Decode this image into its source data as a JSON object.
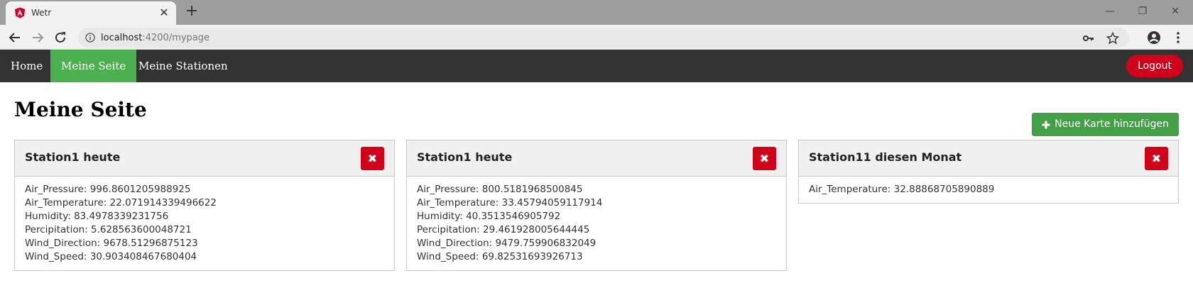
{
  "browser": {
    "tab_title": "Wetr",
    "url_host": "localhost",
    "url_path": ":4200/mypage",
    "icons": {
      "favicon": "angular-icon",
      "close": "close-icon",
      "new_tab": "plus-icon",
      "back": "back-arrow-icon",
      "forward": "forward-arrow-icon",
      "reload": "reload-icon",
      "info": "info-icon",
      "key": "key-icon",
      "star": "star-icon",
      "account": "account-icon",
      "menu": "kebab-menu-icon"
    }
  },
  "navbar": {
    "items": [
      {
        "label": "Home",
        "active": false
      },
      {
        "label": "Meine Seite",
        "active": true
      },
      {
        "label": "Meine Stationen",
        "active": false
      }
    ],
    "logout_label": "Logout",
    "colors": {
      "bg": "#333333",
      "active": "#4caf50",
      "logout": "#d0021b"
    }
  },
  "page": {
    "title": "Meine Seite",
    "add_card_label": "Neue Karte hinzufügen"
  },
  "cards": [
    {
      "title": "Station1 heute",
      "readings": [
        "Air_Pressure: 996.8601205988925",
        "Air_Temperature: 22.071914339496622",
        "Humidity: 83.4978339231756",
        "Percipitation: 5.628563600048721",
        "Wind_Direction: 9678.51296875123",
        "Wind_Speed: 30.903408467680404"
      ]
    },
    {
      "title": "Station1 heute",
      "readings": [
        "Air_Pressure: 800.5181968500845",
        "Air_Temperature: 33.45794059117914",
        "Humidity: 40.3513546905792",
        "Percipitation: 29.461928005644445",
        "Wind_Direction: 9479.759906832049",
        "Wind_Speed: 69.82531693926713"
      ]
    },
    {
      "title": "Station11 diesen Monat",
      "readings": [
        "Air_Temperature: 32.88868705890889"
      ]
    }
  ]
}
